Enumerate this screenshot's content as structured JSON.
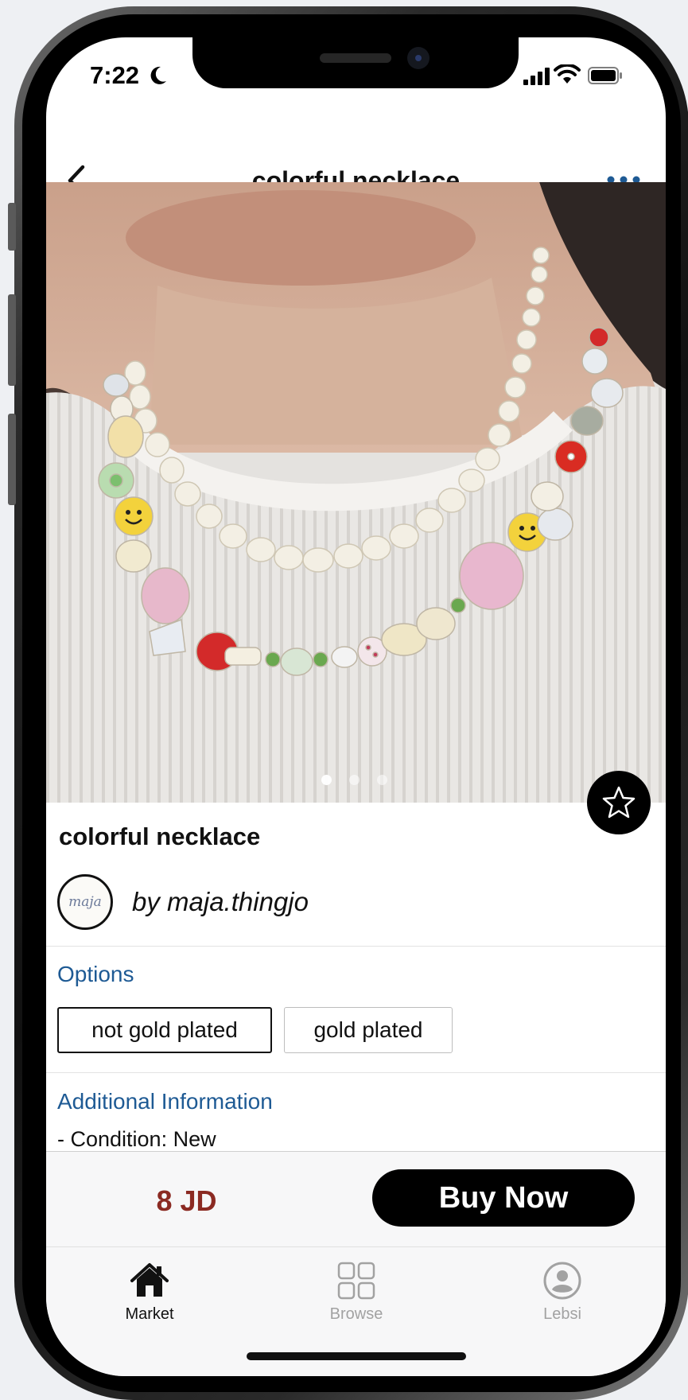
{
  "status_bar": {
    "time": "7:22"
  },
  "nav": {
    "title": "colorful necklace"
  },
  "gallery": {
    "image_count": 3,
    "current_index": 0
  },
  "product": {
    "title": "colorful necklace"
  },
  "seller": {
    "by_line": "by maja.thingjo",
    "avatar_text": "maja"
  },
  "options": {
    "label": "Options",
    "items": [
      {
        "label": "not gold plated",
        "selected": true
      },
      {
        "label": "gold plated",
        "selected": false
      }
    ]
  },
  "additional_info": {
    "label": "Additional Information",
    "condition": "- Condition: New"
  },
  "purchase": {
    "price": "8 JD",
    "buy_label": "Buy Now"
  },
  "tabbar": {
    "items": [
      {
        "label": "Market",
        "icon": "home-icon",
        "active": true
      },
      {
        "label": "Browse",
        "icon": "grid-icon",
        "active": false
      },
      {
        "label": "Lebsi",
        "icon": "user-icon",
        "active": false
      }
    ]
  },
  "colors": {
    "accent_blue": "#1e5a94",
    "price_red": "#8b2a22",
    "button_black": "#000000"
  }
}
